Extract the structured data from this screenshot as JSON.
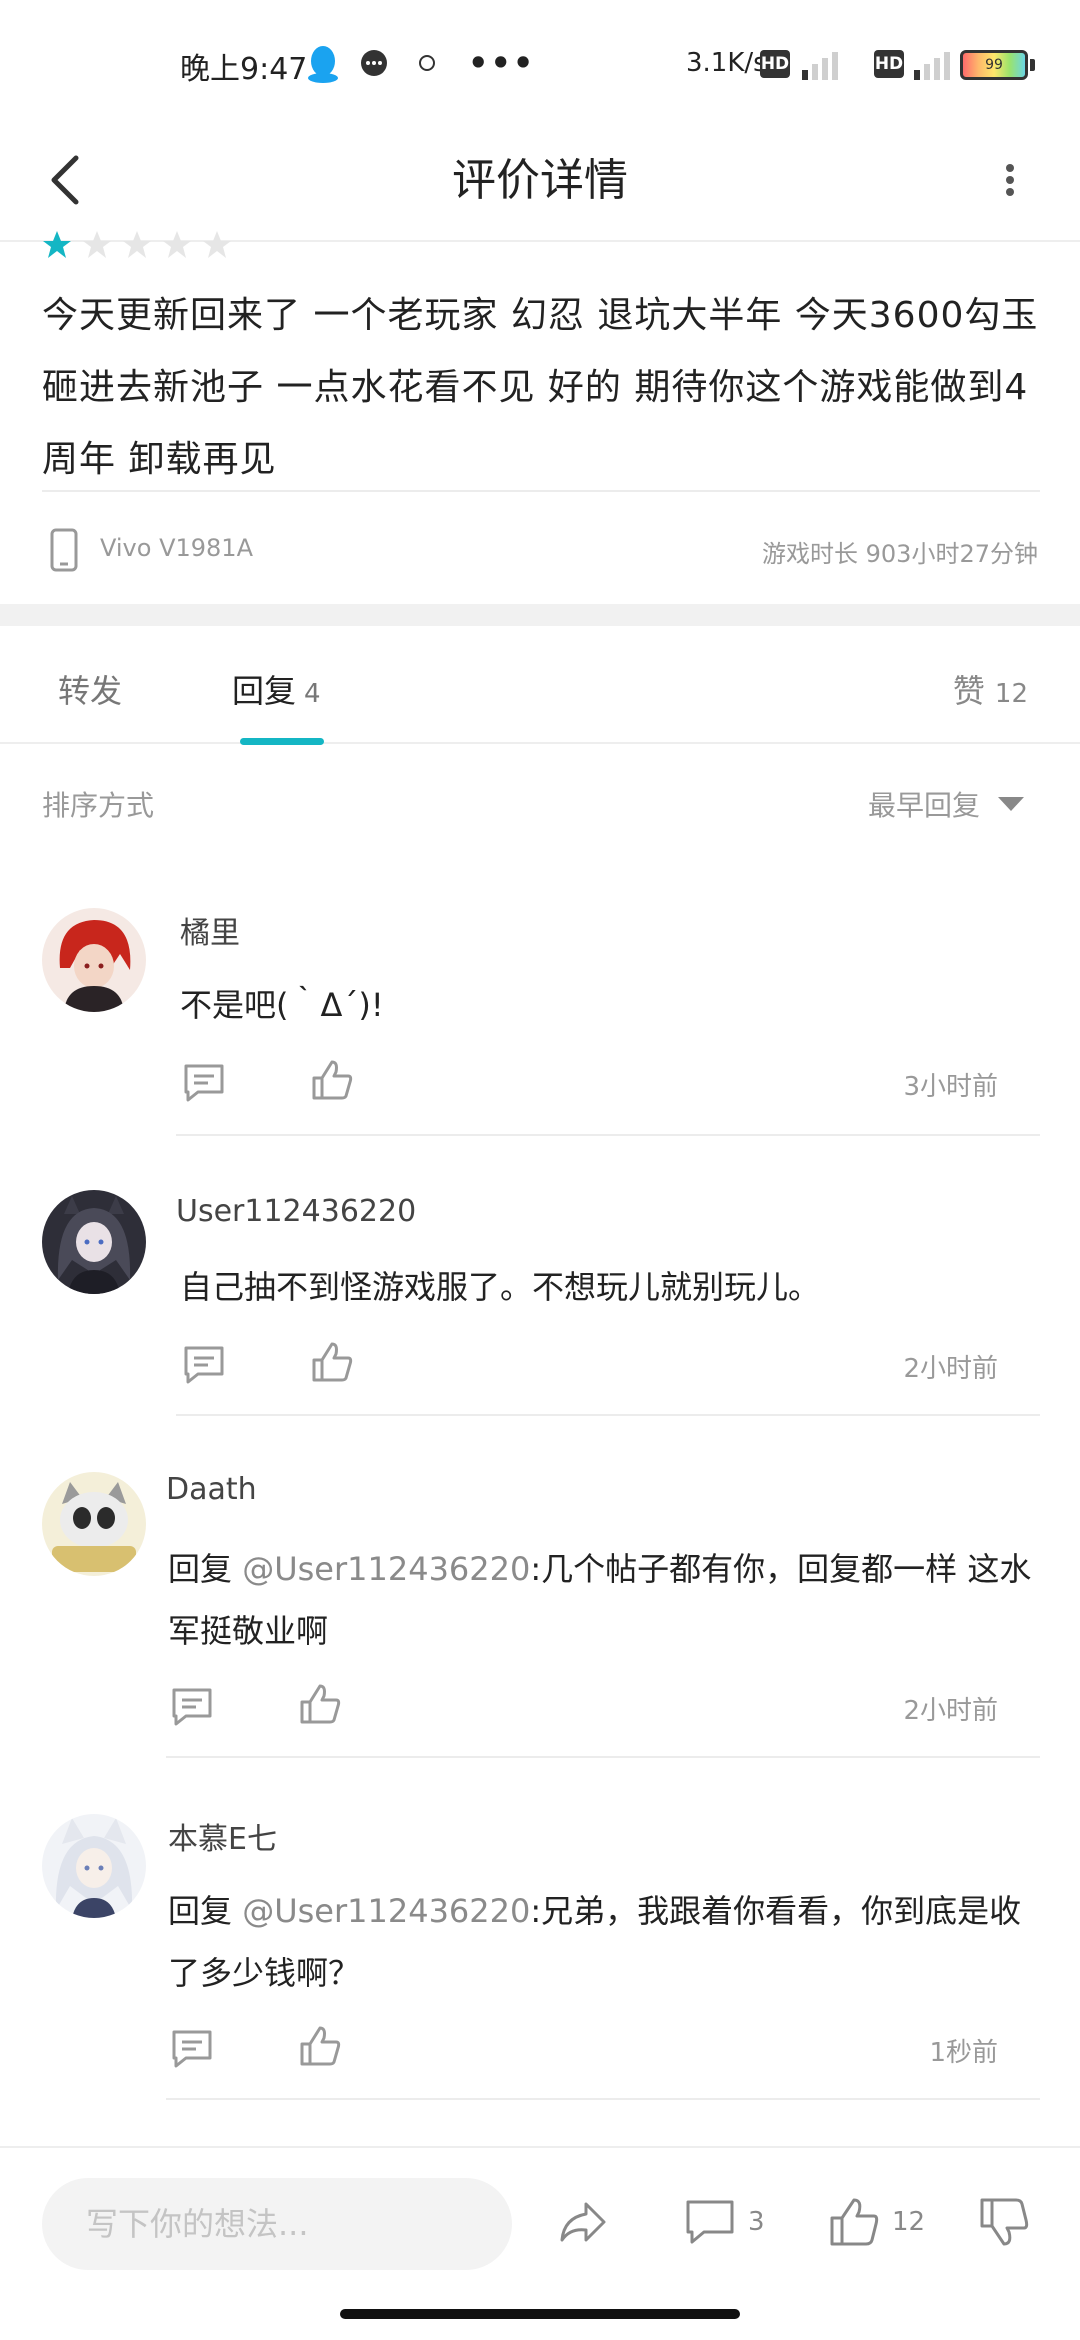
{
  "status_bar": {
    "time": "晚上9:47",
    "net_speed": "3.1K/s",
    "hd_label": "HD",
    "battery": "99"
  },
  "header": {
    "title": "评价详情"
  },
  "review": {
    "rating": 1,
    "rating_max": 5,
    "text": "今天更新回来了 一个老玩家 幻忍 退坑大半年 今天3600勾玉砸进去新池子 一点水花看不见 好的 期待你这个游戏能做到4周年 卸载再见",
    "device": "Vivo V1981A",
    "playtime": "游戏时长 903小时27分钟"
  },
  "tabs": {
    "forward": "转发",
    "reply": "回复",
    "reply_count": "4",
    "likes": "赞",
    "likes_count": "12"
  },
  "sort": {
    "label": "排序方式",
    "selected": "最早回复"
  },
  "comments": [
    {
      "name": "橘里",
      "prefix": "",
      "mention": "",
      "text": "不是吧(｀Δ´)!",
      "time": "3小时前"
    },
    {
      "name": "User112436220",
      "prefix": "",
      "mention": "",
      "text": "自己抽不到怪游戏服了。不想玩儿就别玩儿。",
      "time": "2小时前"
    },
    {
      "name": "Daath",
      "prefix": "回复 ",
      "mention": "@User112436220",
      "text": ":几个帖子都有你，回复都一样 这水军挺敬业啊",
      "time": "2小时前"
    },
    {
      "name": "本慕E七",
      "prefix": "回复 ",
      "mention": "@User112436220",
      "text": ":兄弟，我跟着你看看，你到底是收了多少钱啊？",
      "time": "1秒前"
    }
  ],
  "bottom_bar": {
    "input_placeholder": "写下你的想法...",
    "comment_count": "3",
    "like_count": "12"
  },
  "colors": {
    "accent": "#14b6c4",
    "star_filled": "#14b6c4",
    "star_empty": "#e6e6e6"
  }
}
